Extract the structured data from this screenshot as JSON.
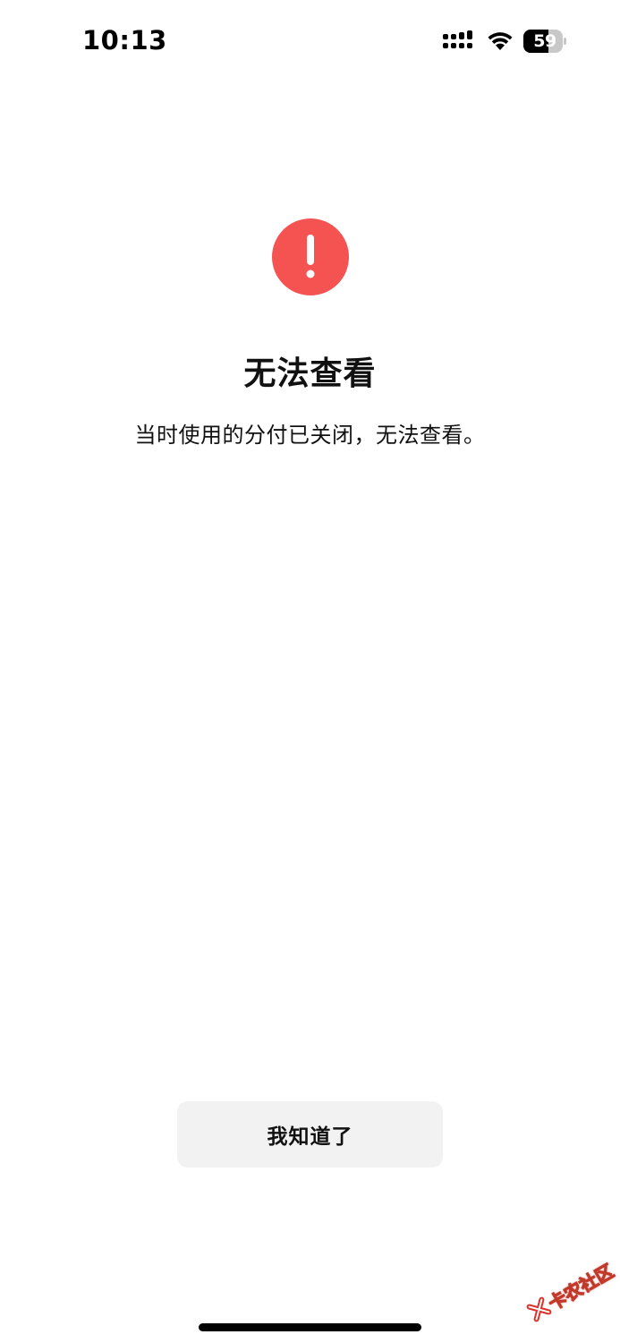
{
  "status_bar": {
    "time": "10:13",
    "battery_level": "59"
  },
  "icons": {
    "signal": "signal-icon",
    "wifi": "wifi-icon",
    "battery": "battery-icon",
    "alert": "exclamation-alert-icon"
  },
  "colors": {
    "alert_red": "#f55252",
    "button_bg": "#f2f2f2",
    "text": "#111111"
  },
  "dialog": {
    "title": "无法查看",
    "message": "当时使用的分付已关闭，无法查看。",
    "ok_button_label": "我知道了"
  },
  "watermark": {
    "text": "卡农社区"
  }
}
